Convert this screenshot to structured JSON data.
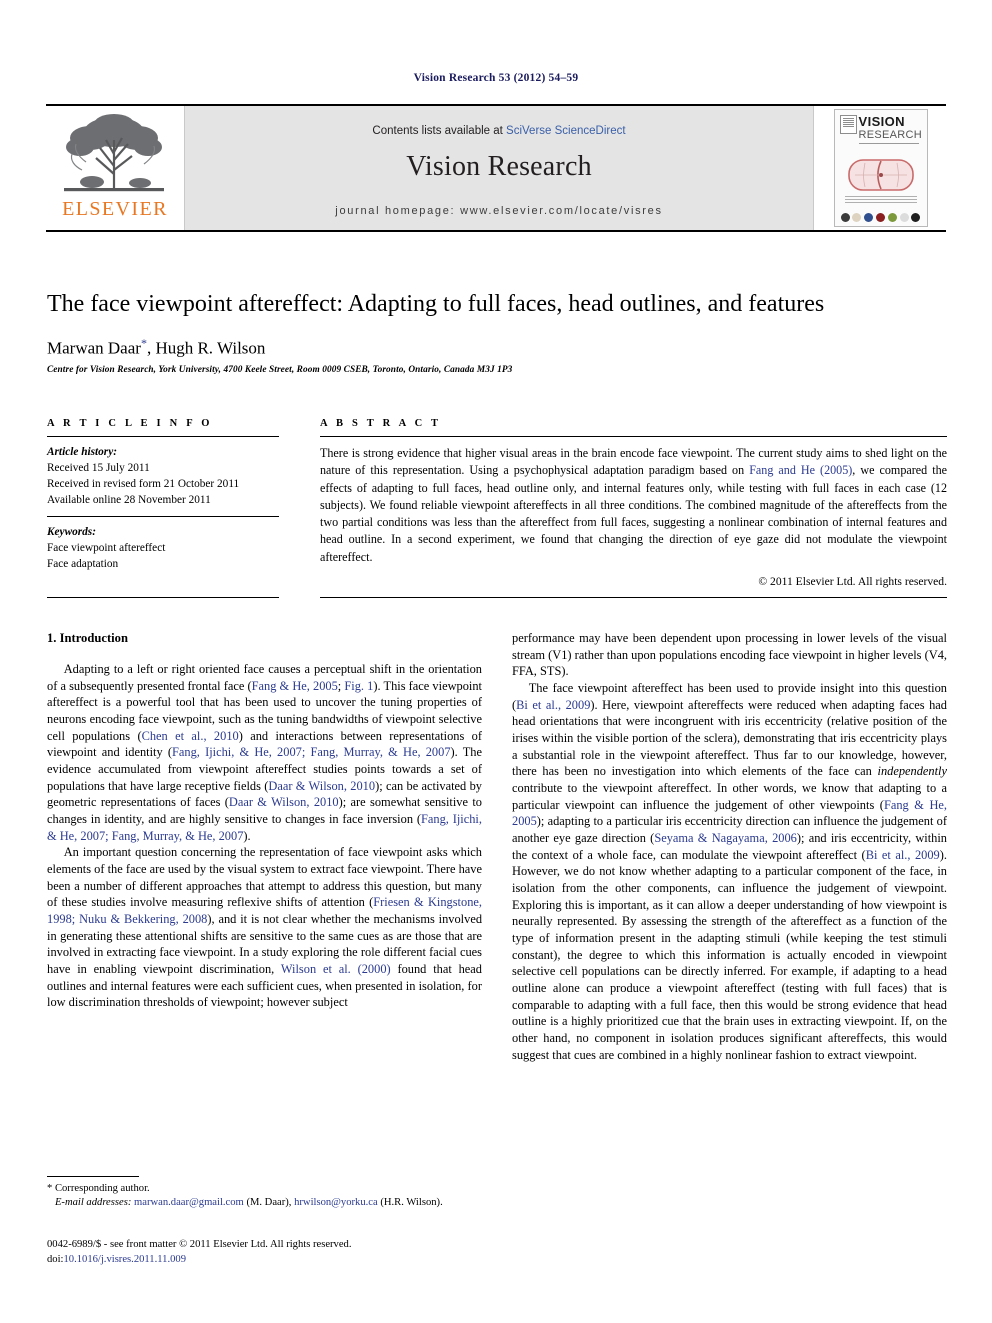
{
  "running_head": "Vision Research 53 (2012) 54–59",
  "masthead": {
    "contents_prefix": "Contents lists available at ",
    "sciencedirect": "SciVerse ScienceDirect",
    "journal_name": "Vision Research",
    "homepage": "journal homepage: www.elsevier.com/locate/visres",
    "publisher_logo_text": "ELSEVIER",
    "cover": {
      "title": "VISION",
      "subtitle": "RESEARCH",
      "tagline": "An International Journal for Functional Aspects of Vision"
    },
    "link_color": "#3a5fa8",
    "band_color": "#e4e4e4",
    "elsevier_orange": "#E87722"
  },
  "article": {
    "title": "The face viewpoint aftereffect: Adapting to full faces, head outlines, and features",
    "authors": "Marwan Daar, Hugh R. Wilson",
    "author_first": "Marwan Daar",
    "author_second": "Hugh R. Wilson",
    "corresponding_marker": "*",
    "affiliation": "Centre for Vision Research, York University, 4700 Keele Street, Room 0009 CSEB, Toronto, Ontario, Canada M3J 1P3"
  },
  "article_info": {
    "heading": "A R T I C L E    I N F O",
    "history_label": "Article history:",
    "history": [
      "Received 15 July 2011",
      "Received in revised form 21 October 2011",
      "Available online 28 November 2011"
    ],
    "keywords_label": "Keywords:",
    "keywords": [
      "Face viewpoint aftereffect",
      "Face adaptation"
    ]
  },
  "abstract": {
    "heading": "A B S T R A C T",
    "part1": "There is strong evidence that higher visual areas in the brain encode face viewpoint. The current study aims to shed light on the nature of this representation. Using a psychophysical adaptation paradigm based on ",
    "citation": "Fang and He (2005)",
    "part2": ", we compared the effects of adapting to full faces, head outline only, and internal features only, while testing with full faces in each case (12 subjects). We found reliable viewpoint aftereffects in all three conditions. The combined magnitude of the aftereffects from the two partial conditions was less than the aftereffect from full faces, suggesting a nonlinear combination of internal features and head outline. In a second experiment, we found that changing the direction of eye gaze did not modulate the viewpoint aftereffect.",
    "copyright": "© 2011 Elsevier Ltd. All rights reserved."
  },
  "body": {
    "section_heading": "1. Introduction",
    "left_paragraphs": [
      {
        "segments": [
          {
            "t": "Adapting to a left or right oriented face causes a perceptual shift in the orientation of a subsequently presented frontal face (",
            "cite": false
          },
          {
            "t": "Fang & He, 2005",
            "cite": true
          },
          {
            "t": "; ",
            "cite": false
          },
          {
            "t": "Fig. 1",
            "cite": true
          },
          {
            "t": "). This face viewpoint aftereffect is a powerful tool that has been used to uncover the tuning properties of neurons encoding face viewpoint, such as the tuning bandwidths of viewpoint selective cell populations (",
            "cite": false
          },
          {
            "t": "Chen et al., 2010",
            "cite": true
          },
          {
            "t": ") and interactions between representations of viewpoint and identity (",
            "cite": false
          },
          {
            "t": "Fang, Ijichi, & He, 2007; Fang, Murray, & He, 2007",
            "cite": true
          },
          {
            "t": "). The evidence accumulated from viewpoint aftereffect studies points towards a set of populations that have large receptive fields (",
            "cite": false
          },
          {
            "t": "Daar & Wilson, 2010",
            "cite": true
          },
          {
            "t": "); can be activated by geometric representations of faces (",
            "cite": false
          },
          {
            "t": "Daar & Wilson, 2010",
            "cite": true
          },
          {
            "t": "); are somewhat sensitive to changes in identity, and are highly sensitive to changes in face inversion (",
            "cite": false
          },
          {
            "t": "Fang, Ijichi, & He, 2007; Fang, Murray, & He, 2007",
            "cite": true
          },
          {
            "t": ").",
            "cite": false
          }
        ]
      },
      {
        "segments": [
          {
            "t": "An important question concerning the representation of face viewpoint asks which elements of the face are used by the visual system to extract face viewpoint. There have been a number of different approaches that attempt to address this question, but many of these studies involve measuring reflexive shifts of attention (",
            "cite": false
          },
          {
            "t": "Friesen & Kingstone, 1998; Nuku & Bekkering, 2008",
            "cite": true
          },
          {
            "t": "), and it is not clear whether the mechanisms involved in generating these attentional shifts are sensitive to the same cues as are those that are involved in extracting face viewpoint. In a study exploring the role different facial cues have in enabling viewpoint discrimination, ",
            "cite": false
          },
          {
            "t": "Wilson et al. (2000)",
            "cite": true
          },
          {
            "t": " found that head outlines and internal features were each sufficient cues, when presented in isolation, for low discrimination thresholds of viewpoint; however subject",
            "cite": false
          }
        ]
      }
    ],
    "right_paragraphs": [
      {
        "noindent": true,
        "segments": [
          {
            "t": "performance may have been dependent upon processing in lower levels of the visual stream (V1) rather than upon populations encoding face viewpoint in higher levels (V4, FFA, STS).",
            "cite": false
          }
        ]
      },
      {
        "segments": [
          {
            "t": "The face viewpoint aftereffect has been used to provide insight into this question (",
            "cite": false
          },
          {
            "t": "Bi et al., 2009",
            "cite": true
          },
          {
            "t": "). Here, viewpoint aftereffects were reduced when adapting faces had head orientations that were incongruent with iris eccentricity (relative position of the irises within the visible portion of the sclera), demonstrating that iris eccentricity plays a substantial role in the viewpoint aftereffect. Thus far to our knowledge, however, there has been no investigation into which elements of the face can ",
            "cite": false
          },
          {
            "t": "independently",
            "cite": false,
            "italic": true
          },
          {
            "t": " contribute to the viewpoint aftereffect. In other words, we know that adapting to a particular viewpoint can influence the judgement of other viewpoints (",
            "cite": false
          },
          {
            "t": "Fang & He, 2005",
            "cite": true
          },
          {
            "t": "); adapting to a particular iris eccentricity direction can influence the judgement of another eye gaze direction (",
            "cite": false
          },
          {
            "t": "Seyama & Nagayama, 2006",
            "cite": true
          },
          {
            "t": "); and iris eccentricity, within the context of a whole face, can modulate the viewpoint aftereffect (",
            "cite": false
          },
          {
            "t": "Bi et al., 2009",
            "cite": true
          },
          {
            "t": "). However, we do not know whether adapting to a particular component of the face, in isolation from the other components, can influence the judgement of viewpoint. Exploring this is important, as it can allow a deeper understanding of how viewpoint is neurally represented. By assessing the strength of the aftereffect as a function of the type of information present in the adapting stimuli (while keeping the test stimuli constant), the degree to which this information is actually encoded in viewpoint selective cell populations can be directly inferred. For example, if adapting to a head outline alone can produce a viewpoint aftereffect (testing with full faces) that is comparable to adapting with a full face, then this would be strong evidence that head outline is a highly prioritized cue that the brain uses in extracting viewpoint. If, on the other hand, no component in isolation produces significant aftereffects, this would suggest that cues are combined in a highly nonlinear fashion to extract viewpoint.",
            "cite": false
          }
        ]
      }
    ]
  },
  "footnote": {
    "corresponding": "* Corresponding author.",
    "email_label": "E-mail addresses:",
    "email1": "marwan.daar@gmail.com",
    "email1_owner": "(M. Daar)",
    "email2": "hrwilson@yorku.ca",
    "email2_owner": "(H.R. Wilson)."
  },
  "imprint": {
    "issn_line": "0042-6989/$ - see front matter © 2011 Elsevier Ltd. All rights reserved.",
    "doi_label": "doi:",
    "doi": "10.1016/j.visres.2011.11.009"
  }
}
